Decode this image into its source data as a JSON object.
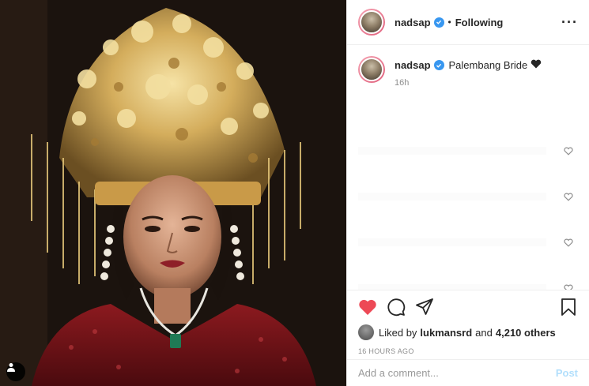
{
  "post": {
    "author": {
      "username": "nadsap",
      "verified": true,
      "follow_status": "Following",
      "separator": "•"
    },
    "caption": {
      "username": "nadsap",
      "text": "Palembang Bride",
      "emoji": "black-heart",
      "time_ago": "16h"
    },
    "comments_count_visible": 4,
    "likes": {
      "prefix": "Liked by",
      "user": "lukmansrd",
      "joiner": "and",
      "others": "4,210 others"
    },
    "timestamp": "16 HOURS AGO",
    "add_comment": {
      "placeholder": "Add a comment...",
      "post_label": "Post"
    },
    "liked": true,
    "icons": [
      "more-options-icon",
      "verified-badge-icon",
      "heart-icon",
      "comment-icon",
      "share-icon",
      "bookmark-icon",
      "user-tag-icon",
      "comment-like-icon"
    ],
    "colors": {
      "like_red": "#ed4956",
      "verified_blue": "#3897f0",
      "post_button_disabled": "#b2dffc",
      "muted_text": "#8e8e8e"
    }
  }
}
